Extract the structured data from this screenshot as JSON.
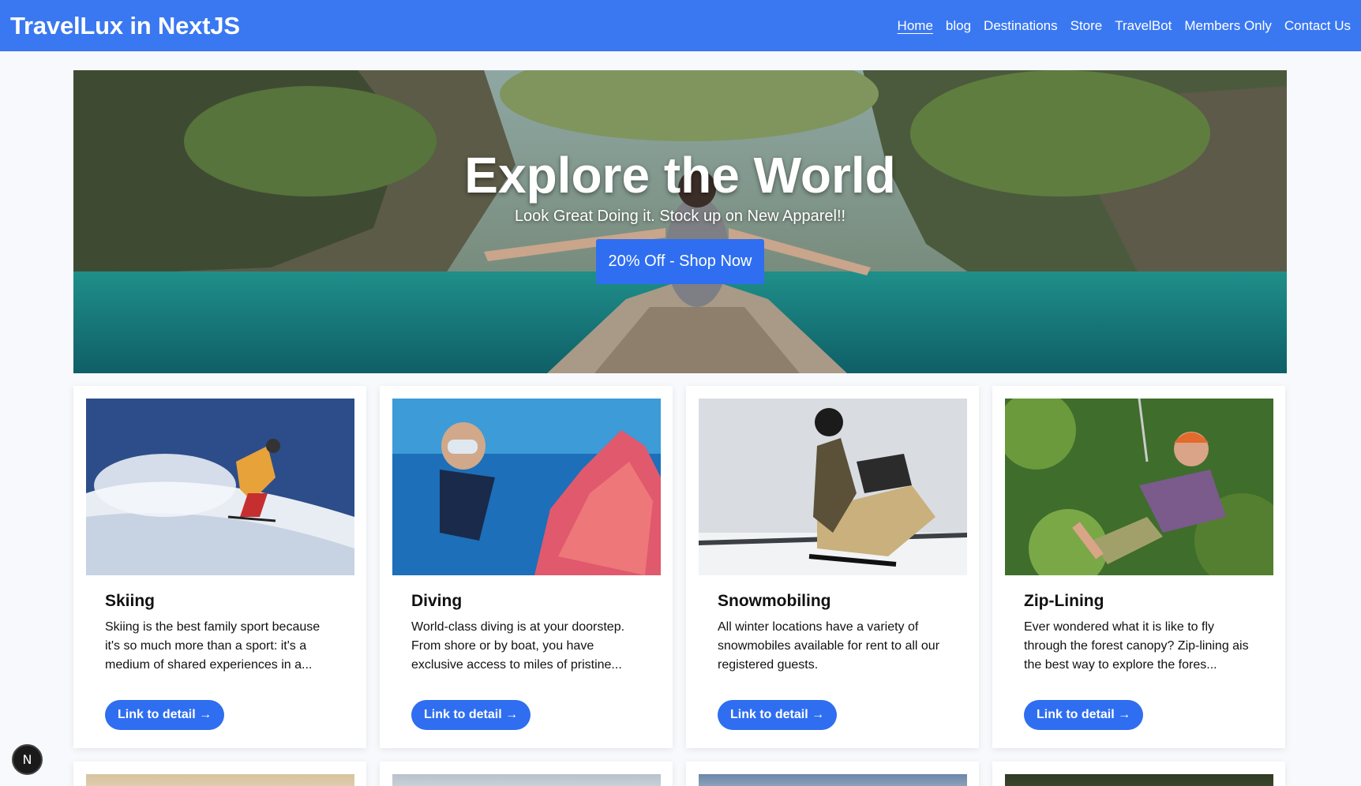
{
  "navbar": {
    "brand": "TravelLux in NextJS",
    "links": [
      "Home",
      "blog",
      "Destinations",
      "Store",
      "TravelBot",
      "Members Only",
      "Contact Us"
    ],
    "active": "Home",
    "background_color": "#3a78f2"
  },
  "hero": {
    "title": "Explore the World",
    "subtitle": "Look Great Doing it. Stock up on New Apparel!!",
    "cta_label": "20% Off - Shop Now"
  },
  "cards": [
    {
      "title": "Skiing",
      "description": "Skiing is the best family sport because it's so much more than a sport: it's a medium of shared experiences in a...",
      "button_label": "Link to detail →"
    },
    {
      "title": "Diving",
      "description": "World-class diving is at your doorstep. From shore or by boat, you have exclusive access to miles of pristine...",
      "button_label": "Link to detail →"
    },
    {
      "title": "Snowmobiling",
      "description": "All winter locations have a variety of snowmobiles available for rent to all our registered guests.",
      "button_label": "Link to detail →"
    },
    {
      "title": "Zip-Lining",
      "description": "Ever wondered what it is like to fly through the forest canopy? Zip-lining ais the best way to explore the fores...",
      "button_label": "Link to detail →"
    }
  ],
  "dev_badge": {
    "label": "N"
  },
  "accent_color": "#2f6ef0"
}
